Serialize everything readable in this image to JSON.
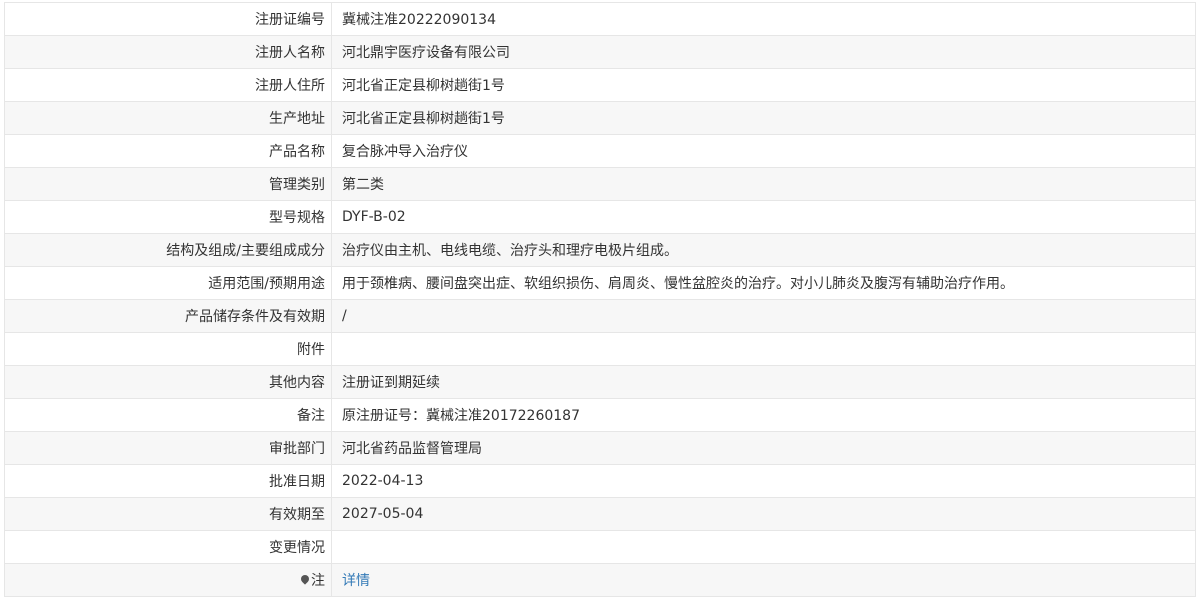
{
  "rows": [
    {
      "label": "注册证编号",
      "value": "冀械注准20222090134"
    },
    {
      "label": "注册人名称",
      "value": "河北鼎宇医疗设备有限公司"
    },
    {
      "label": "注册人住所",
      "value": "河北省正定县柳树趟街1号"
    },
    {
      "label": "生产地址",
      "value": "河北省正定县柳树趟街1号"
    },
    {
      "label": "产品名称",
      "value": "复合脉冲导入治疗仪"
    },
    {
      "label": "管理类别",
      "value": "第二类"
    },
    {
      "label": "型号规格",
      "value": "DYF-B-02"
    },
    {
      "label": "结构及组成/主要组成成分",
      "value": "治疗仪由主机、电线电缆、治疗头和理疗电极片组成。"
    },
    {
      "label": "适用范围/预期用途",
      "value": "用于颈椎病、腰间盘突出症、软组织损伤、肩周炎、慢性盆腔炎的治疗。对小儿肺炎及腹泻有辅助治疗作用。"
    },
    {
      "label": "产品储存条件及有效期",
      "value": "/"
    },
    {
      "label": "附件",
      "value": ""
    },
    {
      "label": "其他内容",
      "value": "注册证到期延续"
    },
    {
      "label": "备注",
      "value": "原注册证号：冀械注准20172260187"
    },
    {
      "label": "审批部门",
      "value": "河北省药品监督管理局"
    },
    {
      "label": "批准日期",
      "value": "2022-04-13"
    },
    {
      "label": "有效期至",
      "value": "2027-05-04"
    },
    {
      "label": "变更情况",
      "value": ""
    }
  ],
  "note_row": {
    "icon": "pin-icon",
    "label": "注",
    "link_text": "详情"
  }
}
